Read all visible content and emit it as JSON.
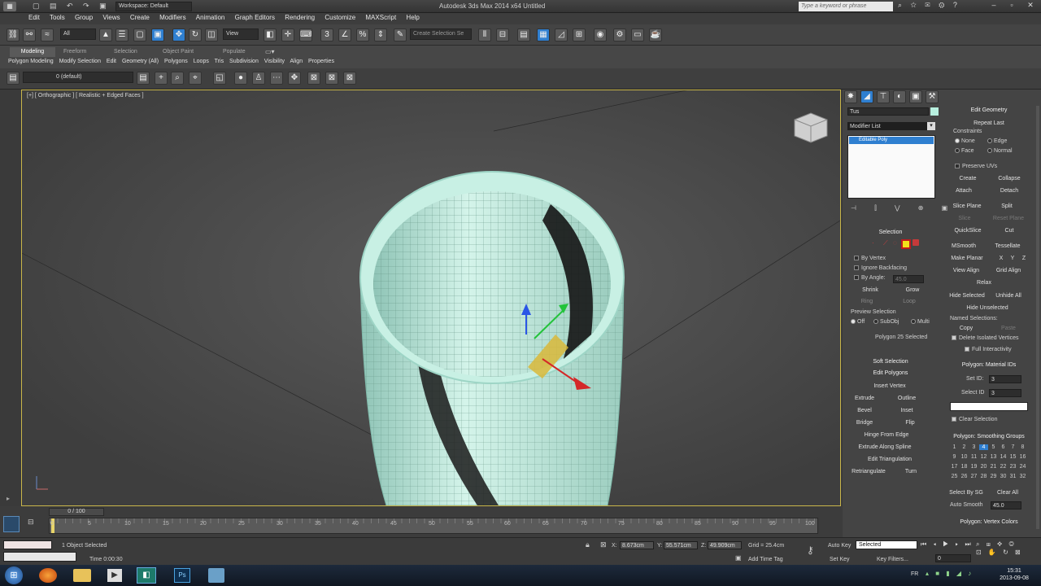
{
  "titlebar": {
    "workspace": "Workspace: Default",
    "title": "Autodesk 3ds Max 2014 x64      Untitled",
    "search_placeholder": "Type a keyword or phrase"
  },
  "menu": [
    "Edit",
    "Tools",
    "Group",
    "Views",
    "Create",
    "Modifiers",
    "Animation",
    "Graph Editors",
    "Rendering",
    "Customize",
    "MAXScript",
    "Help"
  ],
  "toolbar": {
    "filter": "All",
    "refcoord": "View",
    "selset": "Create Selection Se"
  },
  "ribbon": {
    "tabs": [
      "Modeling",
      "Freeform",
      "Selection",
      "Object Paint",
      "Populate"
    ],
    "panels": [
      "Polygon Modeling",
      "Modify Selection",
      "Edit",
      "Geometry (All)",
      "Polygons",
      "Loops",
      "Tris",
      "Subdivision",
      "Visibility",
      "Align",
      "Properties"
    ]
  },
  "layer": {
    "name": "0 (default)"
  },
  "viewport": {
    "label": "[+] [ Orthographic ] [ Realistic + Edged Faces ]"
  },
  "modify": {
    "object_name": "Tus",
    "modifier_list": "Modifier List",
    "stack_item": "Editable Poly",
    "selection": {
      "header": "Selection",
      "by_vertex": "By Vertex",
      "ignore_backfacing": "Ignore Backfacing",
      "by_angle": "By Angle:",
      "by_angle_value": "45.0",
      "shrink": "Shrink",
      "grow": "Grow",
      "ring": "Ring",
      "loop": "Loop",
      "preview_label": "Preview Selection",
      "preview_off": "Off",
      "preview_subobj": "SubObj",
      "preview_multi": "Multi",
      "status": "Polygon 25 Selected"
    },
    "soft_selection": "Soft Selection",
    "edit_polygons": {
      "header": "Edit Polygons",
      "insert_vertex": "Insert Vertex",
      "extrude": "Extrude",
      "outline": "Outline",
      "bevel": "Bevel",
      "inset": "Inset",
      "bridge": "Bridge",
      "flip": "Flip",
      "hinge": "Hinge From Edge",
      "extrude_spline": "Extrude Along Spline",
      "edit_tri": "Edit Triangulation",
      "retriangulate": "Retriangulate",
      "turn": "Turn"
    },
    "edit_geometry": {
      "header": "Edit Geometry",
      "repeat_last": "Repeat Last",
      "constraints": "Constraints",
      "none": "None",
      "edge": "Edge",
      "face": "Face",
      "normal": "Normal",
      "preserve_uvs": "Preserve UVs",
      "create": "Create",
      "collapse": "Collapse",
      "attach": "Attach",
      "detach": "Detach",
      "slice_plane": "Slice Plane",
      "split": "Split",
      "slice": "Slice",
      "reset_plane": "Reset Plane",
      "quickslice": "QuickSlice",
      "cut": "Cut",
      "msmooth": "MSmooth",
      "tessellate": "Tessellate",
      "make_planar": "Make Planar",
      "x": "X",
      "y": "Y",
      "z": "Z",
      "view_align": "View Align",
      "grid_align": "Grid Align",
      "relax": "Relax",
      "hide_selected": "Hide Selected",
      "unhide_all": "Unhide All",
      "hide_unselected": "Hide Unselected",
      "named_selections": "Named Selections:",
      "copy": "Copy",
      "paste": "Paste",
      "delete_isolated": "Delete Isolated Vertices",
      "full_interactivity": "Full Interactivity"
    },
    "material_ids": {
      "header": "Polygon: Material IDs",
      "set_id": "Set ID:",
      "set_id_value": "3",
      "select_id": "Select ID",
      "select_id_value": "3",
      "clear_selection": "Clear Selection"
    },
    "smoothing": {
      "header": "Polygon: Smoothing Groups",
      "groups": [
        "1",
        "2",
        "3",
        "4",
        "5",
        "6",
        "7",
        "8",
        "9",
        "10",
        "11",
        "12",
        "13",
        "14",
        "15",
        "16",
        "17",
        "18",
        "19",
        "20",
        "21",
        "22",
        "23",
        "24",
        "25",
        "26",
        "27",
        "28",
        "29",
        "30",
        "31",
        "32"
      ],
      "select_by_sg": "Select By SG",
      "clear_all": "Clear All",
      "auto_smooth": "Auto Smooth",
      "auto_smooth_value": "45.0"
    },
    "vertex_colors": "Polygon: Vertex Colors"
  },
  "timeline": {
    "frame": "0 / 100",
    "ticks": [
      "0",
      "5",
      "10",
      "15",
      "20",
      "25",
      "30",
      "35",
      "40",
      "45",
      "50",
      "55",
      "60",
      "65",
      "70",
      "75",
      "80",
      "85",
      "90",
      "95",
      "100"
    ]
  },
  "status": {
    "selected": "1 Object Selected",
    "time": "Time  0:00:30",
    "x": "8.673cm",
    "y": "55.571cm",
    "z": "49.909cm",
    "grid": "Grid = 25.4cm",
    "add_time_tag": "Add Time Tag",
    "auto_key": "Auto Key",
    "set_key": "Set Key",
    "key_mode": "Selected",
    "key_filters": "Key Filters...",
    "frame_field": "0"
  },
  "taskbar": {
    "time": "15:31",
    "date": "2013-09-08",
    "lang": "FR"
  },
  "colors": {
    "accent": "#2f7fd0",
    "mesh": "#b8f0df",
    "viewport_border": "#c9b64a"
  }
}
